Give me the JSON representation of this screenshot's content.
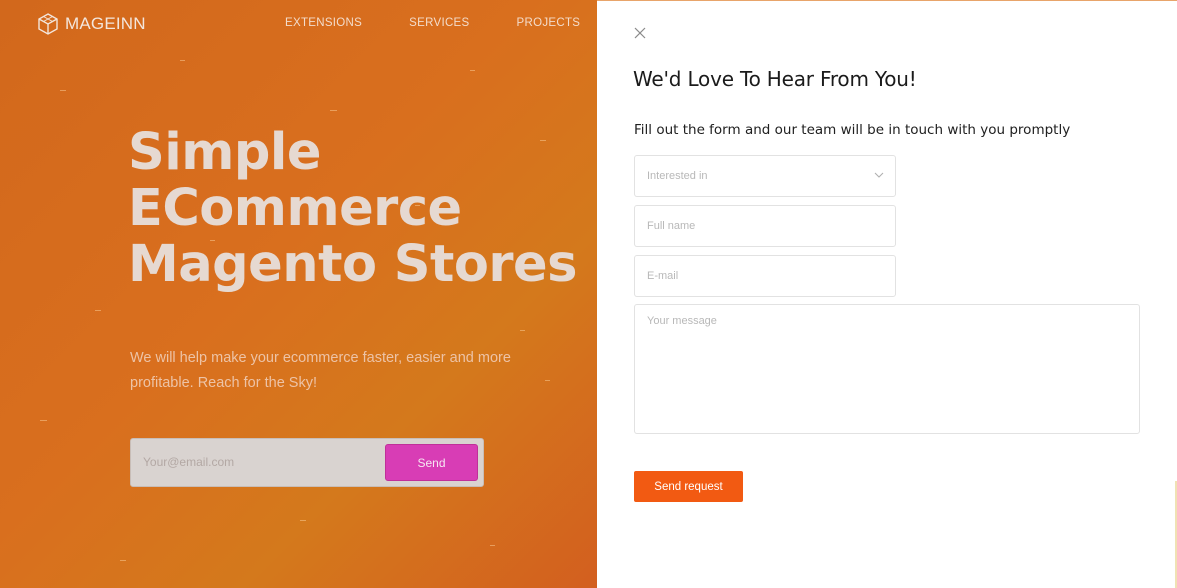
{
  "brand": {
    "name": "MAGEINN",
    "logo_icon": "cube-logo-icon"
  },
  "nav": {
    "items": [
      {
        "label": "EXTENSIONS"
      },
      {
        "label": "SERVICES"
      },
      {
        "label": "PROJECTS"
      }
    ]
  },
  "hero": {
    "title_lines": [
      "Simple",
      "ECommerce",
      "Magento Stores"
    ],
    "subtitle": "We will help make your ecommerce faster, easier and more profitable. Reach for the Sky!",
    "subscribe": {
      "placeholder": "Your@email.com",
      "button_label": "Send"
    }
  },
  "modal": {
    "close_icon": "close-icon",
    "title": "We'd Love To Hear From You!",
    "description": "Fill out the form and our team will be in touch with you promptly",
    "fields": {
      "interested_in": "Interested in",
      "full_name": "Full name",
      "email": "E-mail",
      "message": "Your message"
    },
    "submit_label": "Send request"
  },
  "colors": {
    "hero_orange": "#d96f1e",
    "send_pink": "#d83db5",
    "submit_orange": "#f25a12"
  }
}
